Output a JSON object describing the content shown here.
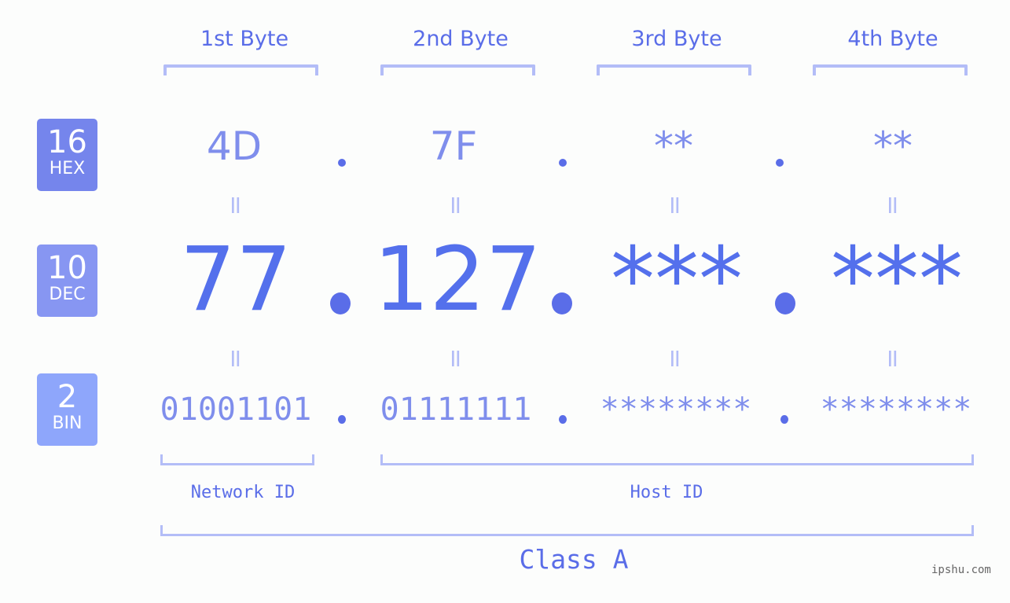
{
  "bytes": [
    {
      "header": "1st Byte",
      "hex": "4D",
      "dec": "77",
      "bin": "01001101"
    },
    {
      "header": "2nd Byte",
      "hex": "7F",
      "dec": "127",
      "bin": "01111111"
    },
    {
      "header": "3rd Byte",
      "hex": "**",
      "dec": "***",
      "bin": "********"
    },
    {
      "header": "4th Byte",
      "hex": "**",
      "dec": "***",
      "bin": "********"
    }
  ],
  "badges": {
    "hex": {
      "number": "16",
      "label": "HEX",
      "color": "#7585ec"
    },
    "dec": {
      "number": "10",
      "label": "DEC",
      "color": "#8796f2"
    },
    "bin": {
      "number": "2",
      "label": "BIN",
      "color": "#8ea6fb"
    }
  },
  "equals_sign": "=",
  "network_id_label": "Network ID",
  "host_id_label": "Host ID",
  "class_label": "Class A",
  "watermark": "ipshu.com",
  "colors": {
    "accent": "#5a6de8",
    "dec_text": "#5470ec",
    "light_text": "#7f8eec",
    "bracket": "#b3bdf7"
  }
}
